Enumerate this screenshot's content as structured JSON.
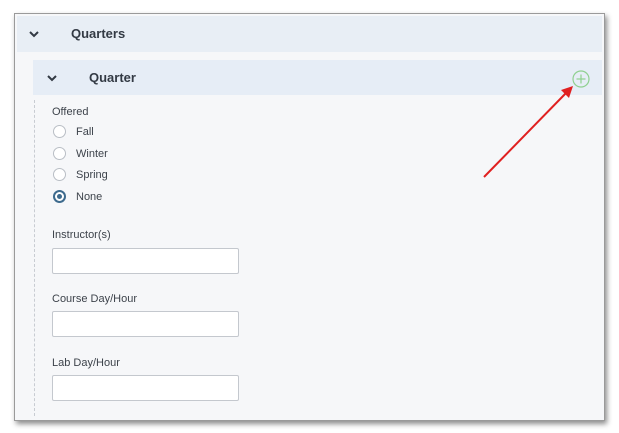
{
  "section": {
    "title": "Quarters"
  },
  "subsection": {
    "title": "Quarter"
  },
  "offered": {
    "label": "Offered",
    "options": [
      "Fall",
      "Winter",
      "Spring",
      "None"
    ],
    "selected": "None"
  },
  "fields": {
    "instructors_label": "Instructor(s)",
    "instructors_value": "",
    "course_label": "Course Day/Hour",
    "course_value": "",
    "lab_label": "Lab Day/Hour",
    "lab_value": ""
  },
  "colors": {
    "accent": "#3e6b8e",
    "add_icon": "#8fd08f",
    "annotation_arrow": "#e02020"
  },
  "icons": {
    "section_toggle": "chevron-down-icon",
    "add": "plus-circle-icon",
    "annotation": "red-arrow-annotation"
  }
}
